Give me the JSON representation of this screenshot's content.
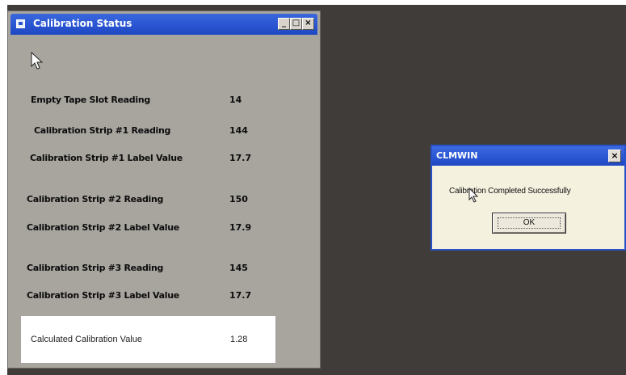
{
  "status_window": {
    "title": "Calibration Status",
    "buttons": {
      "minimize": "_",
      "maximize": "□",
      "close": "×"
    },
    "rows": [
      {
        "label": "Empty Tape Slot Reading",
        "value": "14"
      },
      {
        "label": "Calibration Strip #1 Reading",
        "value": "144"
      },
      {
        "label": "Calibration Strip #1 Label Value",
        "value": "17.7"
      },
      {
        "label": "Calibration Strip #2 Reading",
        "value": "150"
      },
      {
        "label": "Calibration Strip #2 Label Value",
        "value": "17.9"
      },
      {
        "label": "Calibration Strip #3 Reading",
        "value": "145"
      },
      {
        "label": "Calibration Strip #3 Label Value",
        "value": "17.7"
      }
    ],
    "calculated": {
      "label": "Calculated Calibration Value",
      "value": "1.28"
    }
  },
  "message_box": {
    "title": "CLMWIN",
    "close": "×",
    "message": "Calibration Completed Successfully",
    "ok_label": "OK"
  },
  "colors": {
    "desktop": "#3f3c39",
    "window_body": "#a8a59f",
    "titlebar": "#2a55d2",
    "messagebox_body": "#f5f1df"
  },
  "icons": [
    "window-app-icon",
    "mouse-pointer-icon"
  ]
}
